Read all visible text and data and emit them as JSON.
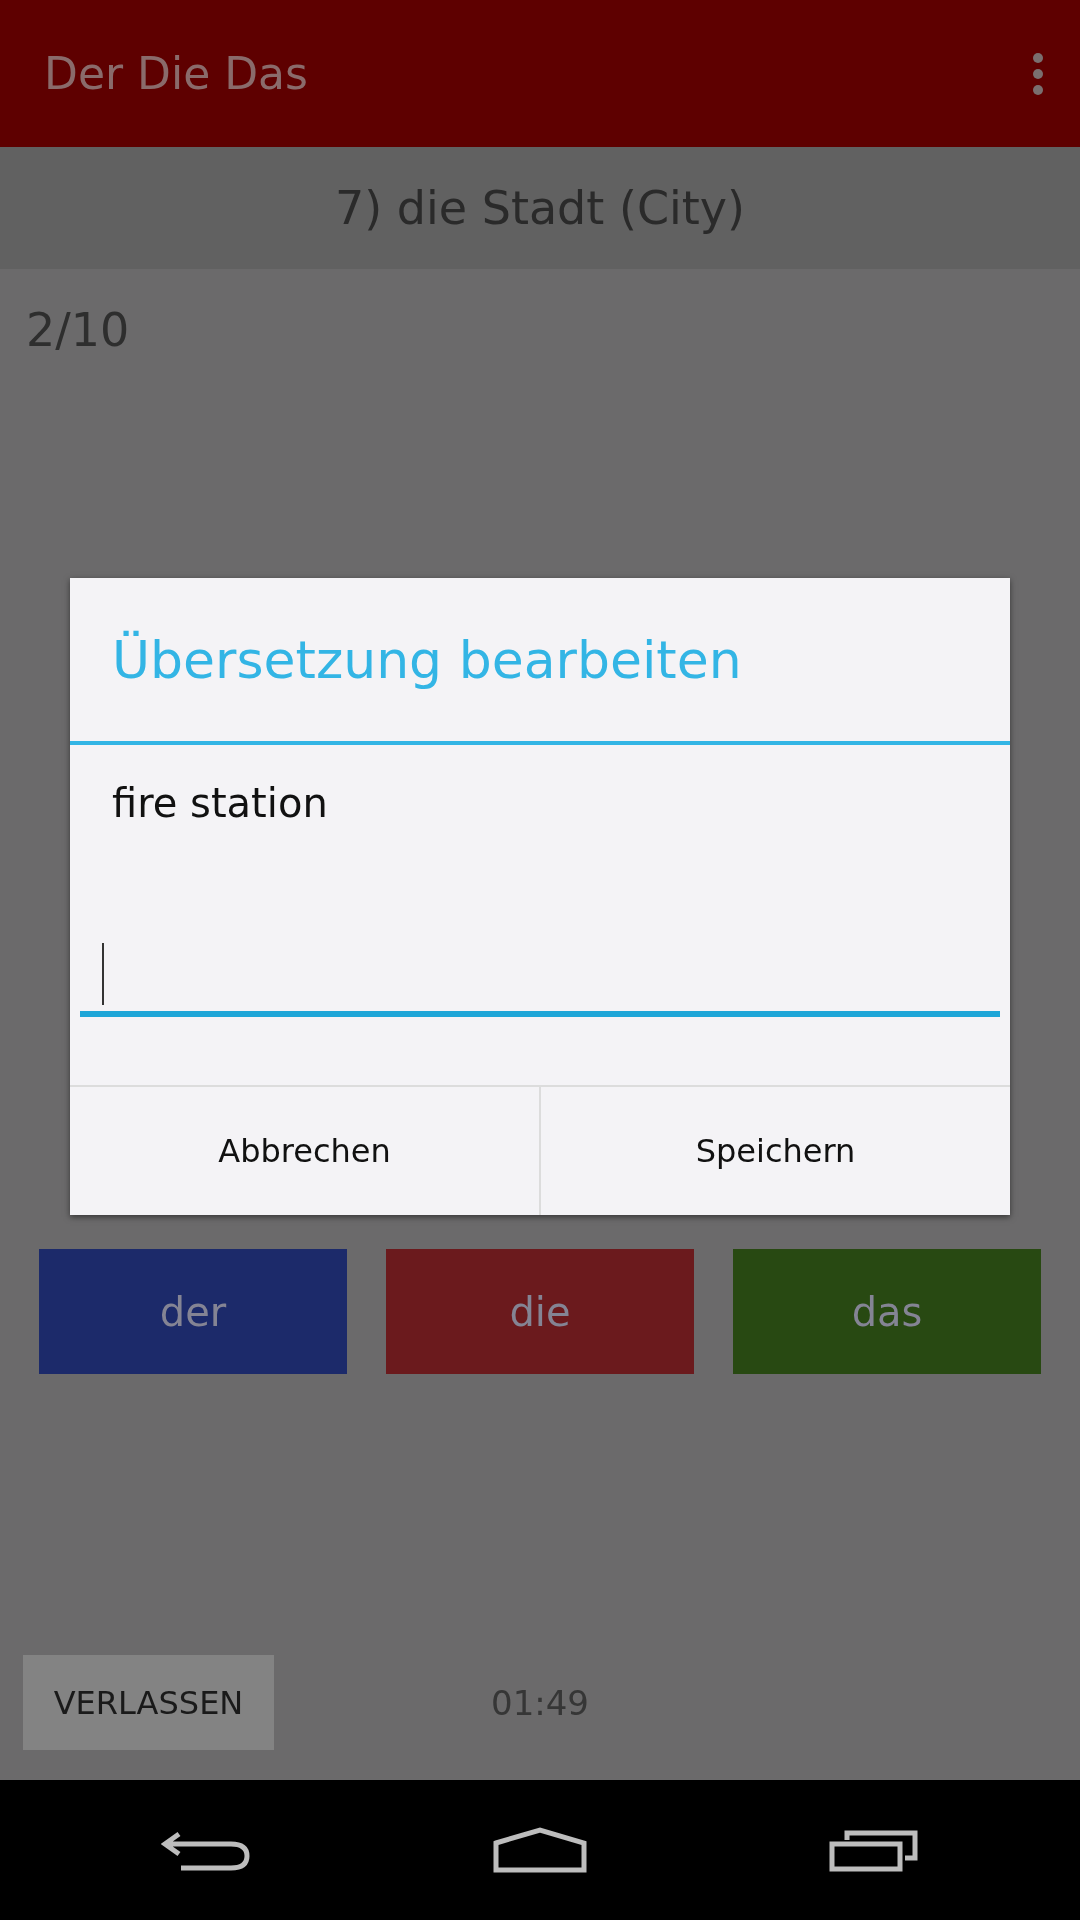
{
  "app_bar": {
    "title": "Der Die Das"
  },
  "question": "7) die Stadt (City)",
  "progress": "2/10",
  "articles": [
    {
      "label": "der",
      "color": "#1c2a6a"
    },
    {
      "label": "die",
      "color": "#6b1a1d"
    },
    {
      "label": "das",
      "color": "#284912"
    }
  ],
  "exit_button": "VERLASSEN",
  "timer": "01:49",
  "dialog": {
    "title": "Übersetzung bearbeiten",
    "translation": "fire station",
    "input": {
      "focused": true
    },
    "buttons": [
      "Abbrechen",
      "Speichern"
    ]
  }
}
